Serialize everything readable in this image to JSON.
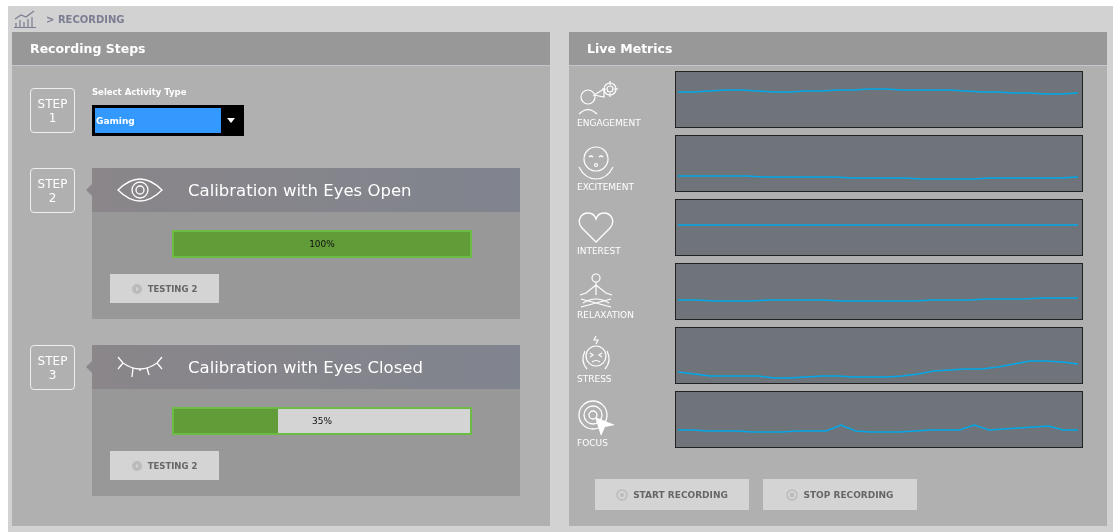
{
  "breadcrumb": {
    "separator": ">",
    "label": "RECORDING"
  },
  "recording_steps": {
    "title": "Recording Steps",
    "steps": [
      {
        "kind": "select",
        "badge": "STEP",
        "number": "1",
        "label": "Select Activity Type",
        "value": "Gaming"
      },
      {
        "kind": "eyes-open",
        "badge": "STEP",
        "number": "2",
        "title": "Calibration with Eyes Open",
        "level": 1.0,
        "reading": "100%",
        "button": "TESTING 2"
      },
      {
        "kind": "eyes-closed",
        "badge": "STEP",
        "number": "3",
        "title": "Calibration with Eyes Closed",
        "level": 0.35,
        "reading": "35%",
        "button": "TESTING 2"
      }
    ]
  },
  "live_metrics": {
    "title": "Live Metrics",
    "metrics": [
      {
        "kind": "engagement",
        "label": "ENGAGEMENT"
      },
      {
        "kind": "excitement",
        "label": "EXCITEMENT"
      },
      {
        "kind": "interest",
        "label": "INTEREST"
      },
      {
        "kind": "relaxation",
        "label": "RELAXATION"
      },
      {
        "kind": "stress",
        "label": "STRESS"
      },
      {
        "kind": "focus",
        "label": "FOCUS"
      }
    ],
    "buttons": [
      {
        "kind": "start",
        "label": "START RECORDING"
      },
      {
        "kind": "stop",
        "label": "STOP RECORDING"
      }
    ]
  }
}
